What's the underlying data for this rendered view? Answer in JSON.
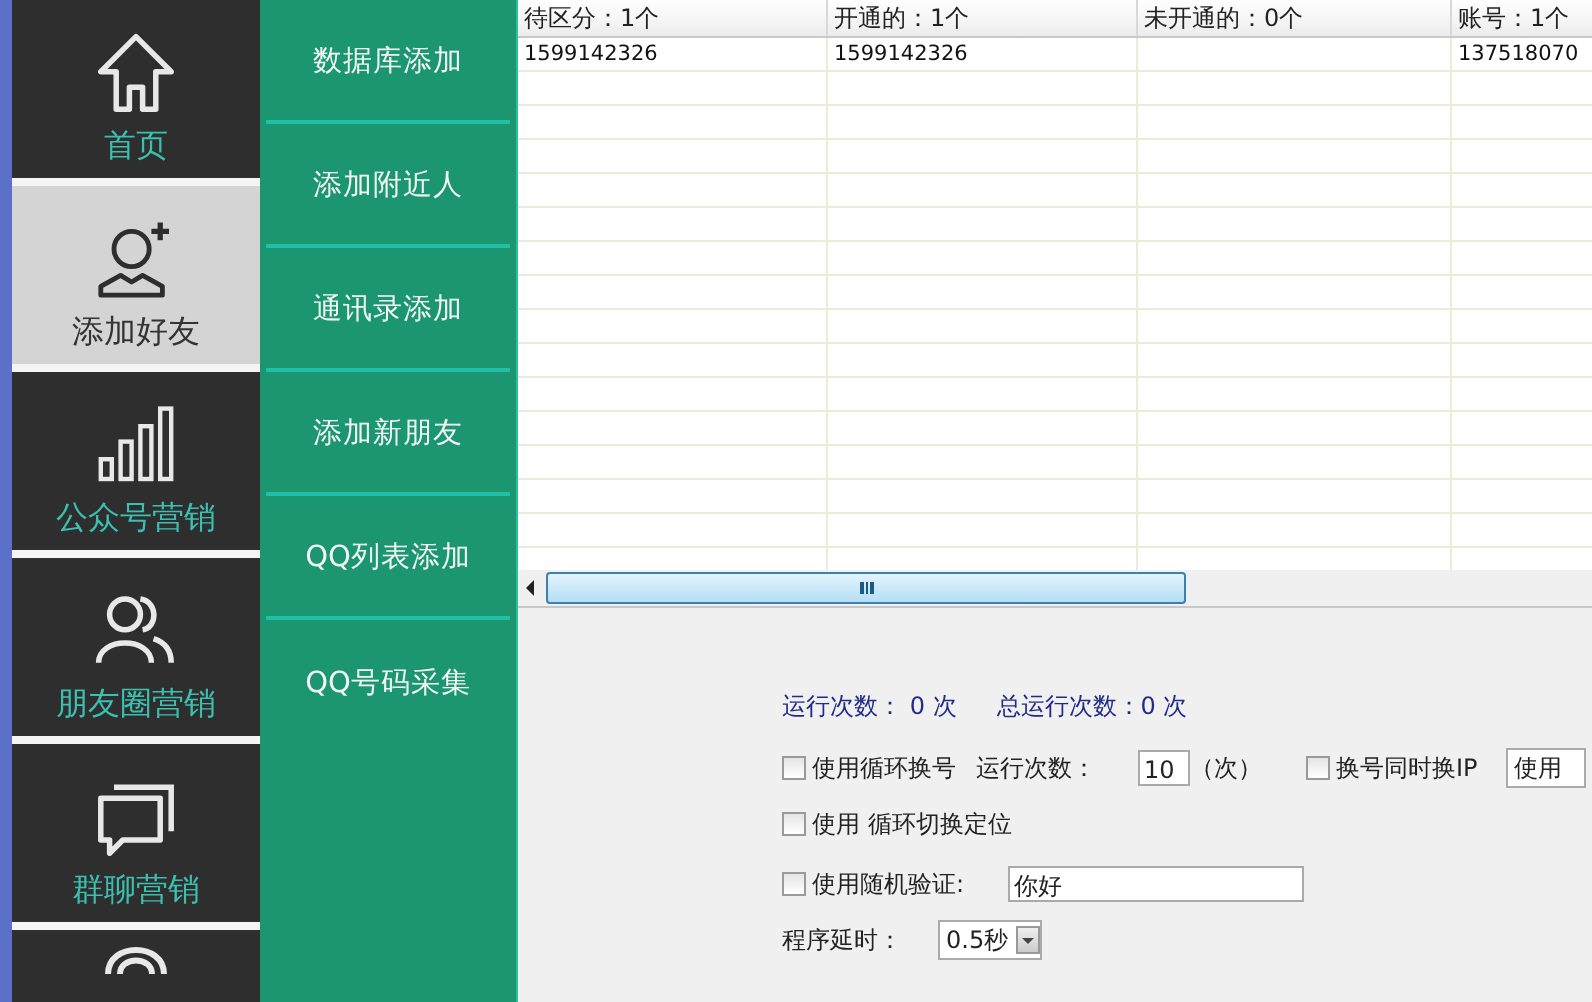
{
  "nav": [
    {
      "kind": "home",
      "label": "首页",
      "selected": false
    },
    {
      "kind": "add-user",
      "label": "添加好友",
      "selected": true
    },
    {
      "kind": "bars",
      "label": "公众号营销",
      "selected": false
    },
    {
      "kind": "people",
      "label": "朋友圈营销",
      "selected": false
    },
    {
      "kind": "chat",
      "label": "群聊营销",
      "selected": false
    },
    {
      "kind": "arc",
      "selected": false
    }
  ],
  "submenu": [
    "数据库添加",
    "添加附近人",
    "通讯录添加",
    "添加新朋友",
    "QQ列表添加",
    "QQ号码采集"
  ],
  "table": {
    "columns": [
      "待区分：1个",
      "开通的：1个",
      "未开通的：0个",
      "账号：1个"
    ],
    "rows": [
      [
        "1599142326",
        "1599142326",
        null,
        "137518070"
      ]
    ]
  },
  "stats": [
    "运行次数： 0 次",
    "总运行次数：0 次"
  ],
  "options": [
    {
      "kind": "loop",
      "checkbox": {
        "label": "使用循环换号",
        "checked": false
      },
      "count_label": "运行次数：",
      "count_value": "10",
      "unit": "（次）",
      "ip_checkbox": {
        "label": "换号同时换IP",
        "checked": false
      },
      "ip_select": "使用"
    },
    {
      "kind": "location",
      "checkbox": {
        "label": "使用 循环切换定位",
        "checked": false
      }
    },
    {
      "kind": "verify",
      "checkbox": {
        "label": "使用随机验证:",
        "checked": false
      },
      "value": "你好"
    },
    {
      "kind": "delay",
      "label": "程序延时：",
      "value": "0.5秒"
    }
  ]
}
